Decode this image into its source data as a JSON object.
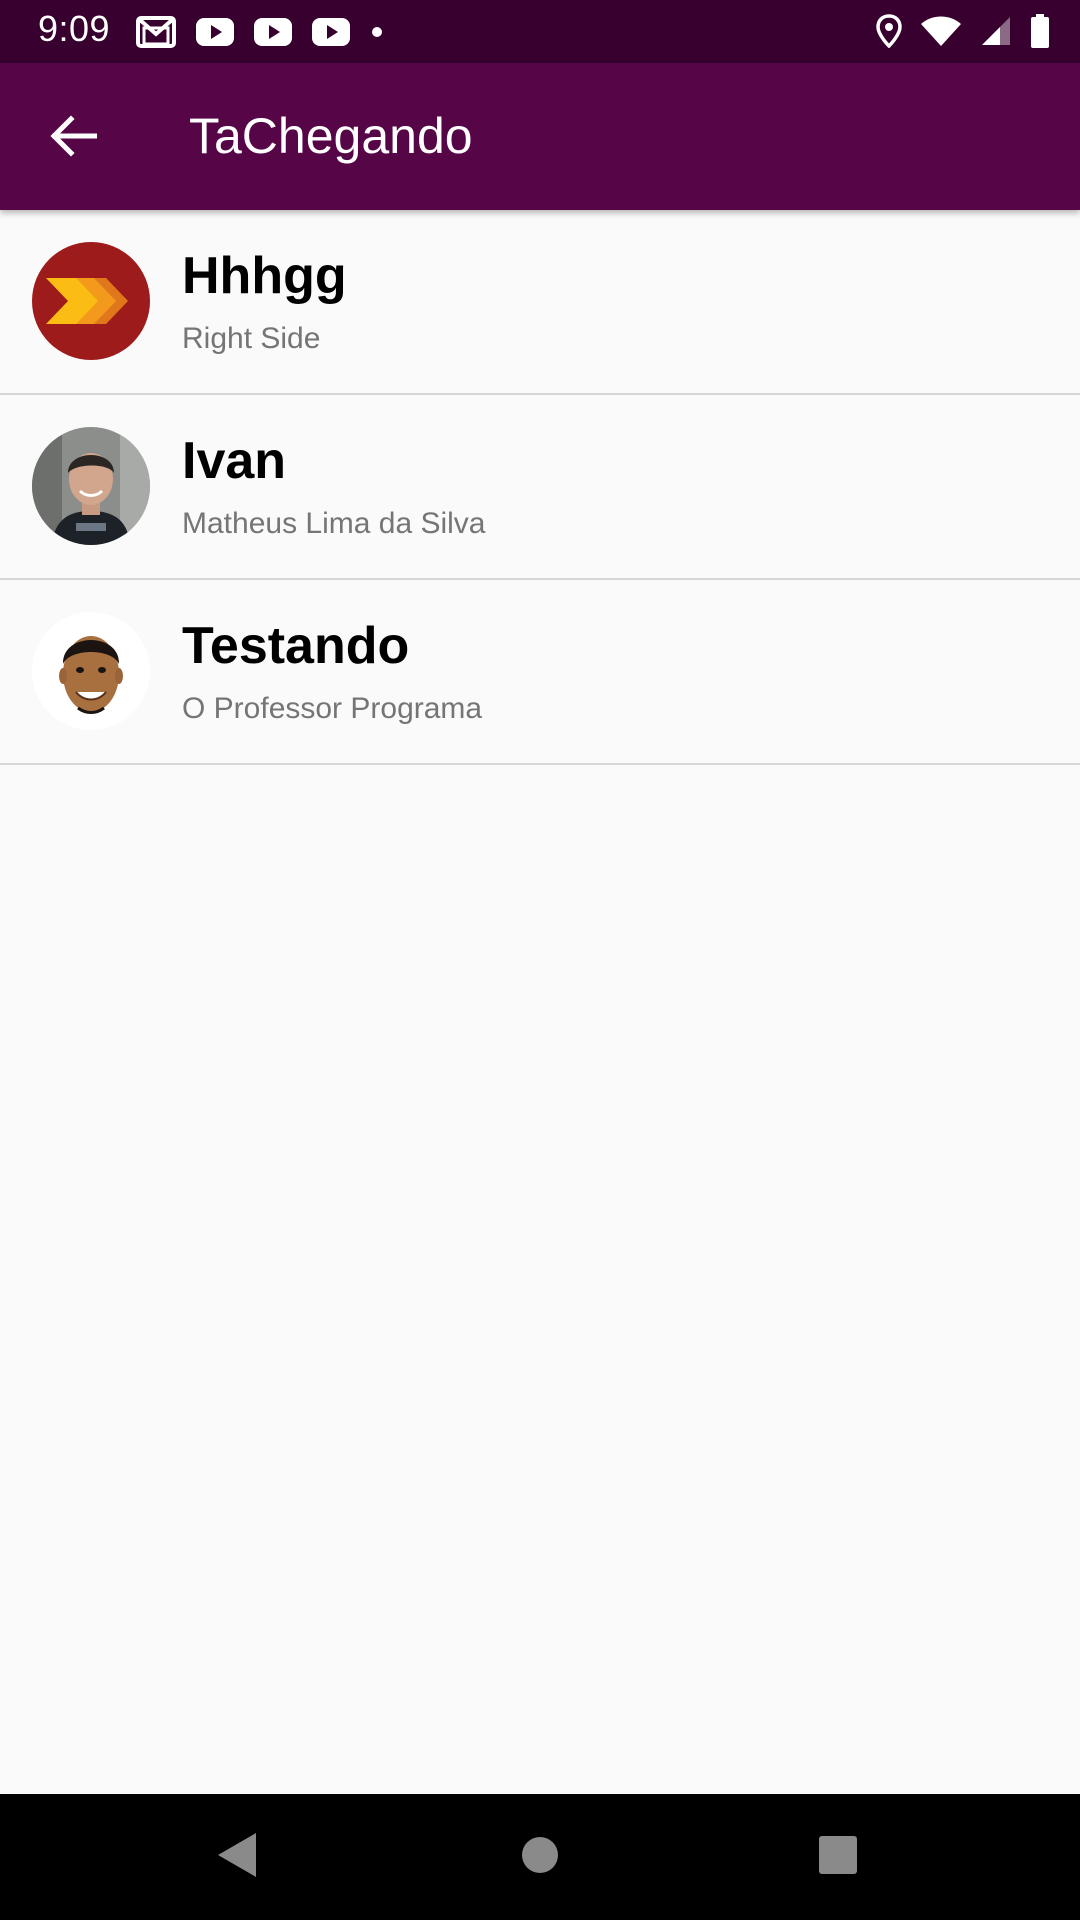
{
  "status_bar": {
    "time": "9:09",
    "left_icons": [
      "gmail-icon",
      "youtube-icon",
      "youtube-icon",
      "youtube-icon",
      "notification-dot-icon"
    ],
    "right_icons": [
      "location-icon",
      "wifi-icon",
      "signal-icon",
      "battery-icon"
    ]
  },
  "app_bar": {
    "title": "TaChegando",
    "back_icon": "arrow-back-icon",
    "background_color": "#560547"
  },
  "contacts": [
    {
      "name": "Hhhgg",
      "subtitle": "Right Side",
      "avatar": "red-chevron-logo"
    },
    {
      "name": "Ivan",
      "subtitle": "Matheus Lima da Silva",
      "avatar": "photo-young-man"
    },
    {
      "name": "Testando",
      "subtitle": "O Professor Programa",
      "avatar": "photo-smiling-man"
    }
  ],
  "nav_bar": {
    "buttons": [
      "back-triangle-icon",
      "home-circle-icon",
      "recents-square-icon"
    ]
  },
  "colors": {
    "status_bar": "#37002e",
    "app_bar": "#560547",
    "background": "#fafafa",
    "subtitle": "#757575"
  }
}
